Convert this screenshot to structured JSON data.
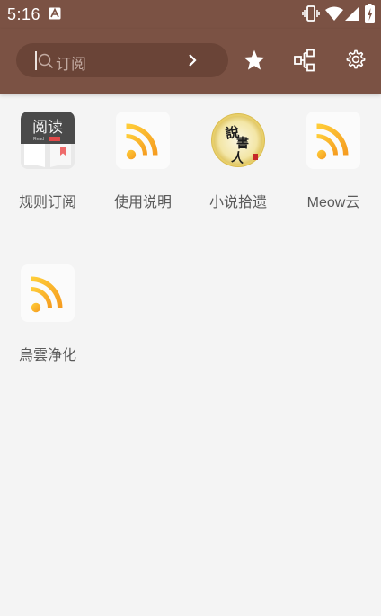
{
  "status_bar": {
    "time": "5:16",
    "icons": [
      "a-font-icon",
      "vibrate-icon",
      "wifi-icon",
      "signal-icon",
      "battery-charging-icon"
    ]
  },
  "toolbar": {
    "search_placeholder": "订阅",
    "buttons": [
      "star-icon",
      "flowchart-icon",
      "settings-gear-icon"
    ]
  },
  "subscriptions": [
    {
      "label": "规则订阅",
      "icon": "read-app-icon"
    },
    {
      "label": "使用说明",
      "icon": "rss-icon"
    },
    {
      "label": "小说拾遗",
      "icon": "shuoshuren-seal-icon"
    },
    {
      "label": "Meow云",
      "icon": "rss-icon"
    },
    {
      "label": "烏雲浄化",
      "icon": "rss-icon"
    }
  ],
  "colors": {
    "toolbar": "#7b5244",
    "search_bg": "#6a4437",
    "background": "#f4f4f4",
    "rss_orange": "#f5a623"
  }
}
